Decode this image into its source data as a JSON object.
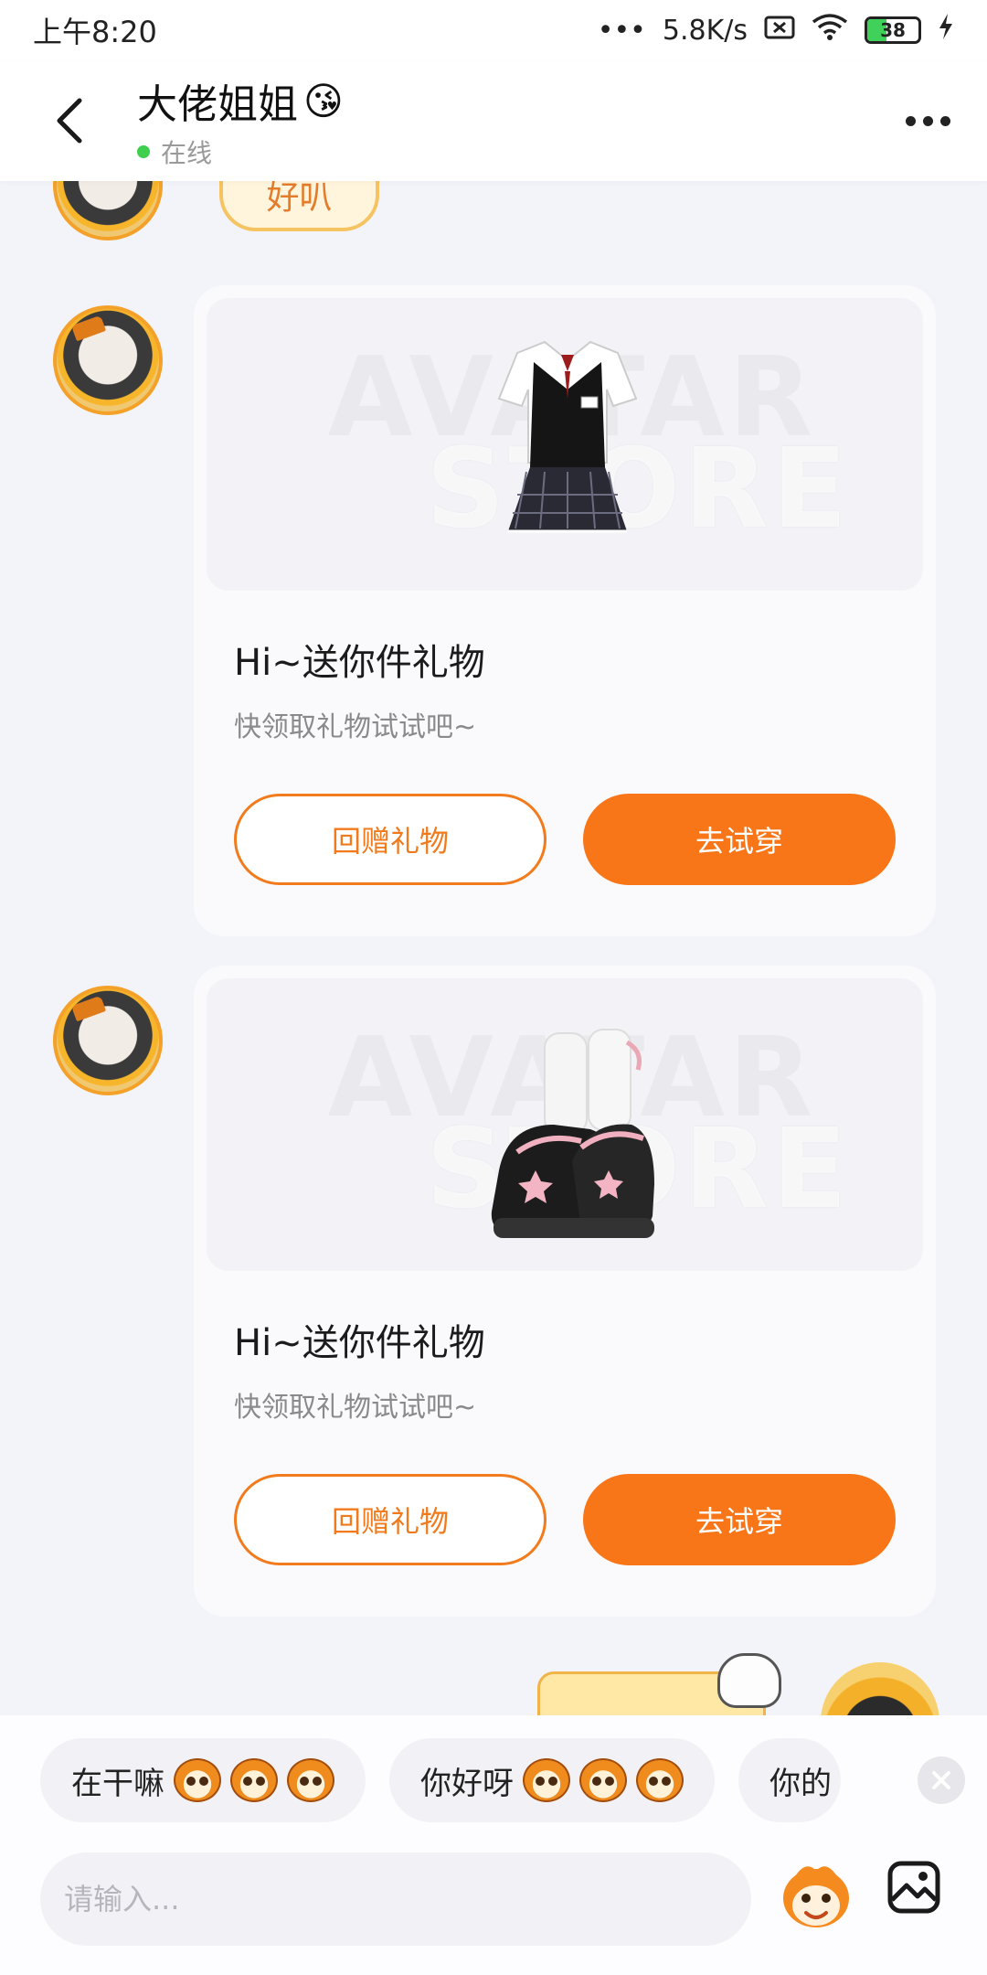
{
  "status_bar": {
    "time": "上午8:20",
    "network_speed": "5.8K/s",
    "battery_level": "38",
    "icons": [
      "signal-dots-icon",
      "sim-off-icon",
      "wifi-icon",
      "battery-icon",
      "charging-icon"
    ]
  },
  "header": {
    "contact_name": "大佬姐姐",
    "name_emoji": "😘",
    "online_status": "在线",
    "online_color": "#3fcf4e"
  },
  "messages": {
    "partial_bubble_text": "好叭",
    "gift_cards": [
      {
        "item": "school-uniform-dress",
        "watermark_line1": "AVATAR",
        "watermark_line2": "STORE",
        "title": "Hi~送你件礼物",
        "subtitle": "快领取礼物试试吧~",
        "return_gift_label": "回赠礼物",
        "try_on_label": "去试穿"
      },
      {
        "item": "platform-shoes-with-socks",
        "watermark_line1": "AVATAR",
        "watermark_line2": "STORE",
        "title": "Hi~送你件礼物",
        "subtitle": "快领取礼物试试吧~",
        "return_gift_label": "回赠礼物",
        "try_on_label": "去试穿"
      }
    ]
  },
  "quick_replies": [
    {
      "text": "在干嘛",
      "faces": 3
    },
    {
      "text": "你好呀",
      "faces": 3
    },
    {
      "text": "你的",
      "faces": 0
    }
  ],
  "input": {
    "placeholder": "请输入..."
  },
  "colors": {
    "accent": "#f97618",
    "background": "#f3f4f9",
    "card": "#fafafd"
  }
}
